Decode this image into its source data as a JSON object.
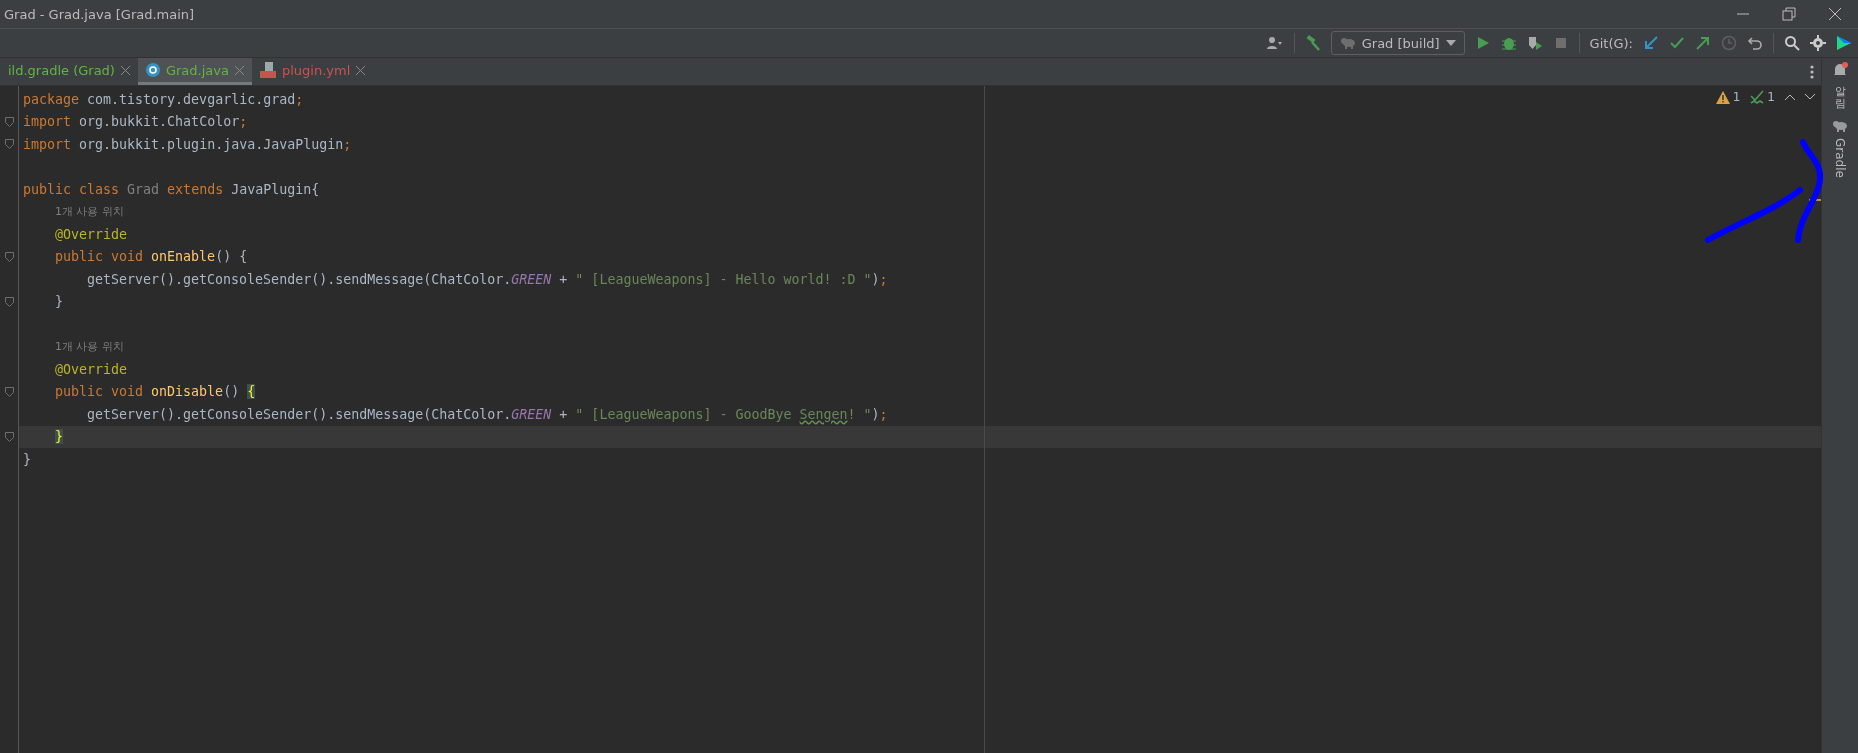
{
  "window": {
    "title": "Grad - Grad.java [Grad.main]"
  },
  "toolbar": {
    "run_config": "Grad [build]",
    "git_label": "Git(G):"
  },
  "tabs": [
    {
      "label": "ild.gradle (Grad)",
      "kind": "gradle",
      "color": "#62b543",
      "selected": false
    },
    {
      "label": "Grad.java",
      "kind": "java",
      "color": "#62b543",
      "selected": true
    },
    {
      "label": "plugin.yml",
      "kind": "yml",
      "color": "#c75450",
      "selected": false
    }
  ],
  "inspections": {
    "warnings": "1",
    "checks": "1"
  },
  "editor": {
    "lines": [
      {
        "kind": "top",
        "fold": false,
        "current": false,
        "tokens": [
          {
            "kind": "kw",
            "text": "package "
          },
          {
            "kind": "plain",
            "text": "com.tistory.devgarlic.grad"
          },
          {
            "kind": "kw",
            "text": ";"
          }
        ]
      },
      {
        "kind": "top",
        "fold": true,
        "current": false,
        "tokens": [
          {
            "kind": "kw",
            "text": "import "
          },
          {
            "kind": "plain",
            "text": "org.bukkit.ChatColor"
          },
          {
            "kind": "kw",
            "text": ";"
          }
        ]
      },
      {
        "kind": "top",
        "fold": true,
        "current": false,
        "tokens": [
          {
            "kind": "kw",
            "text": "import "
          },
          {
            "kind": "plain",
            "text": "org.bukkit.plugin.java.JavaPlugin"
          },
          {
            "kind": "kw",
            "text": ";"
          }
        ]
      },
      {
        "kind": "blank",
        "fold": false,
        "current": false
      },
      {
        "kind": "top",
        "fold": false,
        "current": false,
        "tokens": [
          {
            "kind": "kw",
            "text": "public class "
          },
          {
            "kind": "dim",
            "text": "Grad "
          },
          {
            "kind": "kw",
            "text": "extends "
          },
          {
            "kind": "plain",
            "text": "JavaPlugin{"
          }
        ]
      },
      {
        "kind": "member",
        "fold": false,
        "current": false,
        "tokens": [
          {
            "kind": "hint",
            "text": "1개 사용 위치"
          }
        ]
      },
      {
        "kind": "member",
        "fold": false,
        "current": false,
        "tokens": [
          {
            "kind": "annot",
            "text": "@Override"
          }
        ]
      },
      {
        "kind": "member",
        "fold": true,
        "current": false,
        "tokens": [
          {
            "kind": "kw",
            "text": "public void "
          },
          {
            "kind": "method",
            "text": "onEnable"
          },
          {
            "kind": "plain",
            "text": "() {"
          }
        ]
      },
      {
        "kind": "statement",
        "fold": false,
        "current": false,
        "tokens": [
          {
            "kind": "plain",
            "text": "getServer().getConsoleSender().sendMessage(ChatColor."
          },
          {
            "kind": "static",
            "text": "GREEN"
          },
          {
            "kind": "plain",
            "text": " + "
          },
          {
            "kind": "str",
            "text": "\" [LeagueWeapons] - Hello world! :D \""
          },
          {
            "kind": "plain",
            "text": ")"
          },
          {
            "kind": "kw",
            "text": ";"
          }
        ]
      },
      {
        "kind": "member",
        "fold": true,
        "current": false,
        "tokens": [
          {
            "kind": "plain",
            "text": "}"
          }
        ]
      },
      {
        "kind": "blank",
        "fold": false,
        "current": false
      },
      {
        "kind": "member",
        "fold": false,
        "current": false,
        "tokens": [
          {
            "kind": "hint",
            "text": "1개 사용 위치"
          }
        ]
      },
      {
        "kind": "member",
        "fold": false,
        "current": false,
        "tokens": [
          {
            "kind": "annot",
            "text": "@Override"
          }
        ]
      },
      {
        "kind": "member",
        "fold": true,
        "current": false,
        "tokens": [
          {
            "kind": "kw",
            "text": "public void "
          },
          {
            "kind": "method",
            "text": "onDisable"
          },
          {
            "kind": "plain",
            "text": "() "
          },
          {
            "kind": "brace",
            "text": "{"
          }
        ]
      },
      {
        "kind": "statement",
        "fold": false,
        "current": false,
        "tokens": [
          {
            "kind": "plain",
            "text": "getServer().getConsoleSender().sendMessage(ChatColor."
          },
          {
            "kind": "static",
            "text": "GREEN"
          },
          {
            "kind": "plain",
            "text": " + "
          },
          {
            "kind": "str",
            "text": "\" [LeagueWeapons] - GoodBye "
          },
          {
            "kind": "typo",
            "text": "Sengen"
          },
          {
            "kind": "str",
            "text": "! \""
          },
          {
            "kind": "plain",
            "text": ")"
          },
          {
            "kind": "kw",
            "text": ";"
          }
        ]
      },
      {
        "kind": "member",
        "fold": true,
        "current": true,
        "tokens": [
          {
            "kind": "brace",
            "text": "}"
          }
        ]
      },
      {
        "kind": "top",
        "fold": false,
        "current": false,
        "tokens": [
          {
            "kind": "plain",
            "text": "}"
          }
        ]
      }
    ]
  },
  "right_strip": [
    {
      "kind": "cjk",
      "label": "알림"
    },
    {
      "kind": "latin",
      "label": "Gradle"
    }
  ]
}
